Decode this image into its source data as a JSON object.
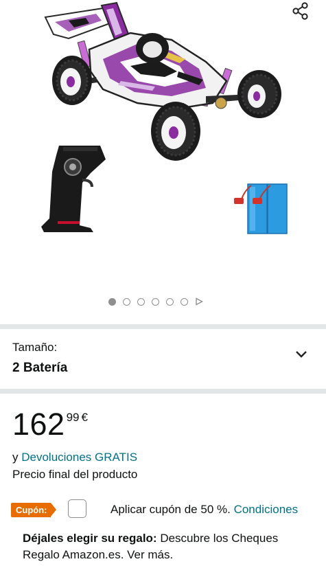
{
  "gallery": {
    "image_alt": "Coche RC buggy morado con mando y baterías",
    "dot_count": 6,
    "active_dot": 0
  },
  "size": {
    "label": "Tamaño:",
    "value": "2 Batería"
  },
  "price": {
    "whole": "162",
    "fraction": "99",
    "currency": "€"
  },
  "returns": {
    "prefix": "y ",
    "link": "Devoluciones GRATIS"
  },
  "final_price_label": "Precio final del producto",
  "coupon": {
    "badge": "Cupón:",
    "text": "Aplicar cupón de 50 %.",
    "link": "Condiciones",
    "checked": false
  },
  "gift": {
    "bold": "Déjales elegir su regalo:",
    "text": " Descubre los Cheques Regalo Amazon.es. Ver más."
  },
  "colors": {
    "link": "#007185",
    "coupon_badge": "#e76d00",
    "separator": "#e3e6e6",
    "car_accent": "#8a2ba0"
  }
}
